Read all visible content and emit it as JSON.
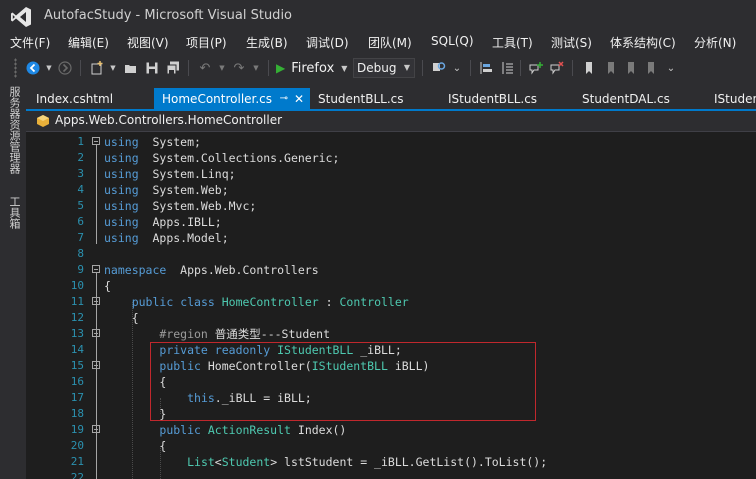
{
  "window": {
    "title": "AutofacStudy - Microsoft Visual Studio"
  },
  "menu": [
    {
      "id": "file",
      "label": "文件(F)"
    },
    {
      "id": "edit",
      "label": "编辑(E)"
    },
    {
      "id": "view",
      "label": "视图(V)"
    },
    {
      "id": "project",
      "label": "项目(P)"
    },
    {
      "id": "build",
      "label": "生成(B)"
    },
    {
      "id": "debug",
      "label": "调试(D)"
    },
    {
      "id": "team",
      "label": "团队(M)"
    },
    {
      "id": "sql",
      "label": "SQL(Q)"
    },
    {
      "id": "tools",
      "label": "工具(T)"
    },
    {
      "id": "test",
      "label": "测试(S)"
    },
    {
      "id": "architecture",
      "label": "体系结构(C)"
    },
    {
      "id": "analyze",
      "label": "分析(N)"
    }
  ],
  "toolbar": {
    "run_target": "Firefox",
    "configuration": "Debug",
    "icons": [
      "back-icon",
      "forward-icon",
      "new-project-icon",
      "open-icon",
      "save-icon",
      "save-all-icon",
      "undo-icon",
      "redo-icon",
      "start-icon",
      "find-icon",
      "bookmark-icon"
    ]
  },
  "left_strip": {
    "server_explorer": "服务器资源管理器",
    "toolbox": "工具箱"
  },
  "tabs": [
    {
      "id": "index",
      "label": "Index.cshtml",
      "active": false
    },
    {
      "id": "homecontroller",
      "label": "HomeController.cs",
      "active": true
    },
    {
      "id": "studentbll",
      "label": "StudentBLL.cs",
      "active": false
    },
    {
      "id": "istudentbll",
      "label": "IStudentBLL.cs",
      "active": false
    },
    {
      "id": "studentdal",
      "label": "StudentDAL.cs",
      "active": false
    },
    {
      "id": "istudentdal",
      "label": "IStuden",
      "active": false
    }
  ],
  "tab_controls": {
    "pin": "⊸",
    "close": "✕"
  },
  "navigation": {
    "path": "Apps.Web.Controllers.HomeController"
  },
  "code": {
    "lines": [
      {
        "n": "1",
        "t": [
          [
            "kw",
            "using"
          ],
          [
            "",
            "  System;"
          ]
        ]
      },
      {
        "n": "2",
        "t": [
          [
            "kw",
            "using"
          ],
          [
            "",
            "  System.Collections.Generic;"
          ]
        ]
      },
      {
        "n": "3",
        "t": [
          [
            "kw",
            "using"
          ],
          [
            "",
            "  System.Linq;"
          ]
        ]
      },
      {
        "n": "4",
        "t": [
          [
            "kw",
            "using"
          ],
          [
            "",
            "  System.Web;"
          ]
        ]
      },
      {
        "n": "5",
        "t": [
          [
            "kw",
            "using"
          ],
          [
            "",
            "  System.Web.Mvc;"
          ]
        ]
      },
      {
        "n": "6",
        "t": [
          [
            "kw",
            "using"
          ],
          [
            "",
            "  Apps.IBLL;"
          ]
        ]
      },
      {
        "n": "7",
        "t": [
          [
            "kw",
            "using"
          ],
          [
            "",
            "  Apps.Model;"
          ]
        ]
      },
      {
        "n": "8",
        "t": []
      },
      {
        "n": "9",
        "t": [
          [
            "kw",
            "namespace"
          ],
          [
            "",
            "  Apps.Web.Controllers"
          ]
        ]
      },
      {
        "n": "10",
        "t": [
          [
            "",
            "{"
          ]
        ]
      },
      {
        "n": "11",
        "t": [
          [
            "",
            "    "
          ],
          [
            "kw",
            "public"
          ],
          [
            "",
            " "
          ],
          [
            "kw",
            "class"
          ],
          [
            "",
            " "
          ],
          [
            "ty",
            "HomeController"
          ],
          [
            "",
            " : "
          ],
          [
            "ty",
            "Controller"
          ]
        ]
      },
      {
        "n": "12",
        "t": [
          [
            "",
            "    {"
          ]
        ]
      },
      {
        "n": "13",
        "t": [
          [
            "",
            "        "
          ],
          [
            "pp",
            "#region"
          ],
          [
            "",
            " 普通类型---Student"
          ]
        ]
      },
      {
        "n": "14",
        "t": [
          [
            "",
            "        "
          ],
          [
            "kw",
            "private"
          ],
          [
            "",
            " "
          ],
          [
            "kw",
            "readonly"
          ],
          [
            "",
            " "
          ],
          [
            "ty",
            "IStudentBLL"
          ],
          [
            "",
            " _iBLL;"
          ]
        ]
      },
      {
        "n": "15",
        "t": [
          [
            "",
            "        "
          ],
          [
            "kw",
            "public"
          ],
          [
            "",
            " HomeController("
          ],
          [
            "ty",
            "IStudentBLL"
          ],
          [
            "",
            " iBLL)"
          ]
        ]
      },
      {
        "n": "16",
        "t": [
          [
            "",
            "        {"
          ]
        ]
      },
      {
        "n": "17",
        "t": [
          [
            "",
            "            "
          ],
          [
            "kw",
            "this"
          ],
          [
            "",
            "._iBLL = iBLL;"
          ]
        ]
      },
      {
        "n": "18",
        "t": [
          [
            "",
            "        }"
          ]
        ]
      },
      {
        "n": "19",
        "t": [
          [
            "",
            "        "
          ],
          [
            "kw",
            "public"
          ],
          [
            "",
            " "
          ],
          [
            "ty",
            "ActionResult"
          ],
          [
            "",
            " Index()"
          ]
        ]
      },
      {
        "n": "20",
        "t": [
          [
            "",
            "        {"
          ]
        ]
      },
      {
        "n": "21",
        "t": [
          [
            "",
            "            "
          ],
          [
            "ty",
            "List"
          ],
          [
            "",
            "<"
          ],
          [
            "ty",
            "Student"
          ],
          [
            "",
            "> lstStudent = _iBLL.GetList().ToList();"
          ]
        ]
      },
      {
        "n": "22",
        "t": []
      }
    ]
  }
}
